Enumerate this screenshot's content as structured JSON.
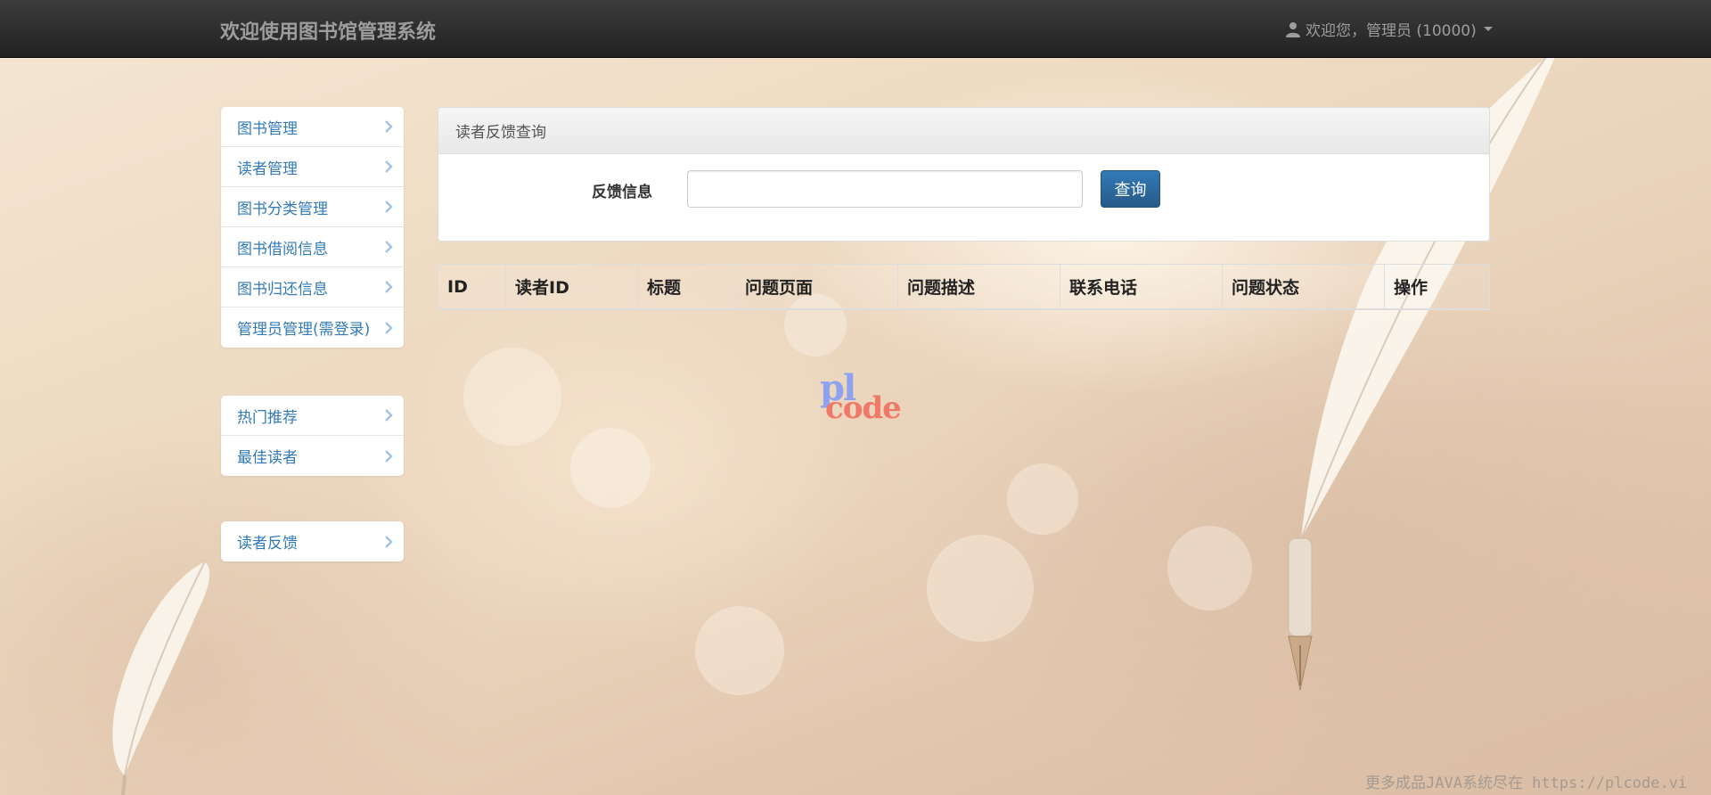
{
  "navbar": {
    "brand": "欢迎使用图书馆管理系统",
    "user_menu_label": "欢迎您，管理员 (10000)"
  },
  "sidebar": {
    "groups": [
      {
        "items": [
          {
            "label": "图书管理"
          },
          {
            "label": "读者管理"
          },
          {
            "label": "图书分类管理"
          },
          {
            "label": "图书借阅信息"
          },
          {
            "label": "图书归还信息"
          },
          {
            "label": "管理员管理(需登录)"
          }
        ]
      },
      {
        "items": [
          {
            "label": "热门推荐"
          },
          {
            "label": "最佳读者"
          }
        ]
      },
      {
        "items": [
          {
            "label": "读者反馈"
          }
        ]
      }
    ]
  },
  "query_panel": {
    "title": "读者反馈查询",
    "field_label": "反馈信息",
    "input_value": "",
    "button_label": "查询"
  },
  "table": {
    "columns": [
      "ID",
      "读者ID",
      "标题",
      "问题页面",
      "问题描述",
      "联系电话",
      "问题状态",
      "操作"
    ],
    "rows": []
  },
  "watermark": {
    "logo_top": "pl",
    "logo_bottom": "code",
    "footer_text": "更多成品JAVA系统尽在 https://plcode.vi"
  },
  "colors": {
    "navbar_bg": "#222222",
    "link": "#337ab7",
    "primary_button": "#337ab7"
  }
}
